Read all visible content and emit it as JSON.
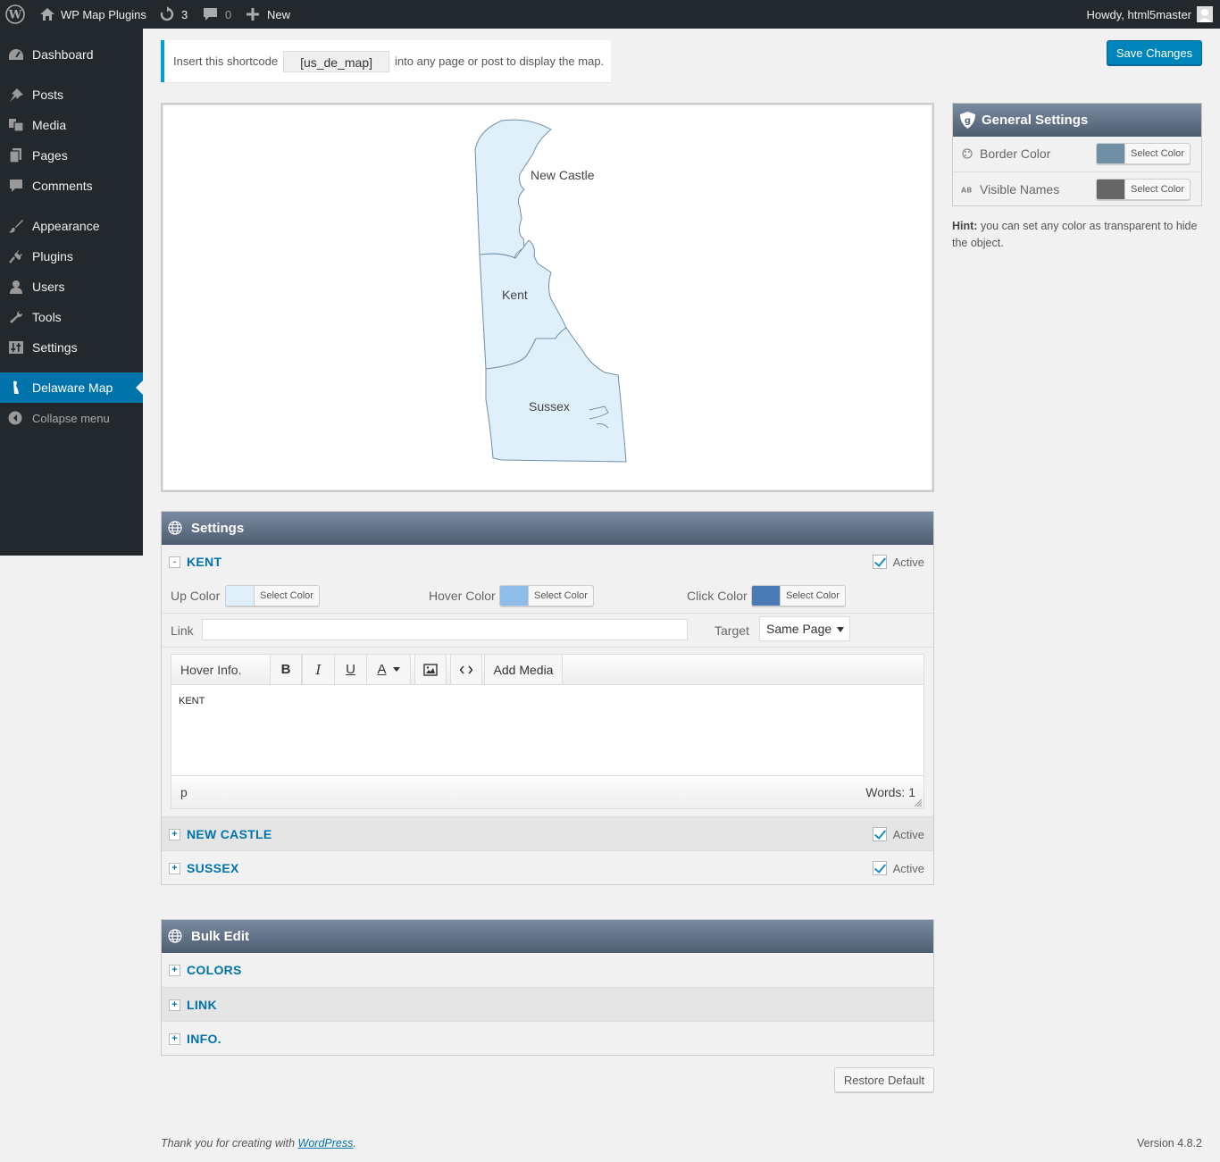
{
  "adminbar": {
    "site_name": "WP Map Plugins",
    "updates_count": "3",
    "comments_count": "0",
    "new_label": "New",
    "howdy": "Howdy, html5master"
  },
  "sidebar": {
    "items": [
      {
        "label": "Dashboard",
        "icon": "dashboard-icon"
      },
      {
        "label": "Posts",
        "icon": "pin-icon"
      },
      {
        "label": "Media",
        "icon": "media-icon"
      },
      {
        "label": "Pages",
        "icon": "pages-icon"
      },
      {
        "label": "Comments",
        "icon": "comment-icon"
      },
      {
        "label": "Appearance",
        "icon": "brush-icon"
      },
      {
        "label": "Plugins",
        "icon": "plug-icon"
      },
      {
        "label": "Users",
        "icon": "user-icon"
      },
      {
        "label": "Tools",
        "icon": "wrench-icon"
      },
      {
        "label": "Settings",
        "icon": "sliders-icon"
      },
      {
        "label": "Delaware Map",
        "icon": "delaware-icon"
      }
    ],
    "collapse_label": "Collapse menu"
  },
  "notice": {
    "prefix": "Insert this shortcode",
    "shortcode": "[us_de_map]",
    "suffix": "into any page or post to display the map."
  },
  "save_label": "Save Changes",
  "map": {
    "regions": [
      {
        "name": "New Castle"
      },
      {
        "name": "Kent"
      },
      {
        "name": "Sussex"
      }
    ],
    "fill_color": "#e0f0fb",
    "stroke_color": "#6f8ea4"
  },
  "settings_panel": {
    "title": "Settings",
    "active_label": "Active",
    "expanded_region": "KENT",
    "up_color_label": "Up Color",
    "hover_color_label": "Hover Color",
    "click_color_label": "Click Color",
    "select_color_label": "Select Color",
    "up_color": "#e0f0fb",
    "hover_color": "#8dbde8",
    "click_color": "#4a7ab5",
    "link_label": "Link",
    "link_value": "",
    "target_label": "Target",
    "target_value": "Same Page",
    "editor": {
      "hover_info_label": "Hover Info.",
      "bold": "B",
      "italic": "I",
      "underline": "U",
      "text_color": "A",
      "add_media": "Add Media",
      "content": "KENT",
      "path": "p",
      "word_count": "Words: 1"
    },
    "collapsed_regions": [
      "NEW CASTLE",
      "SUSSEX"
    ]
  },
  "bulk_panel": {
    "title": "Bulk Edit",
    "sections": [
      "COLORS",
      "LINK",
      "INFO."
    ]
  },
  "restore_label": "Restore Default",
  "general_settings": {
    "title": "General Settings",
    "border_color_label": "Border Color",
    "visible_names_label": "Visible Names",
    "select_color_label": "Select Color",
    "border_color": "#6e8fa5",
    "names_color": "#666666"
  },
  "hint": {
    "bold": "Hint:",
    "text": " you can set any color as transparent to hide the object."
  },
  "footer": {
    "thanks": "Thank you for creating with ",
    "wp_link": "WordPress",
    "version": "Version 4.8.2"
  }
}
